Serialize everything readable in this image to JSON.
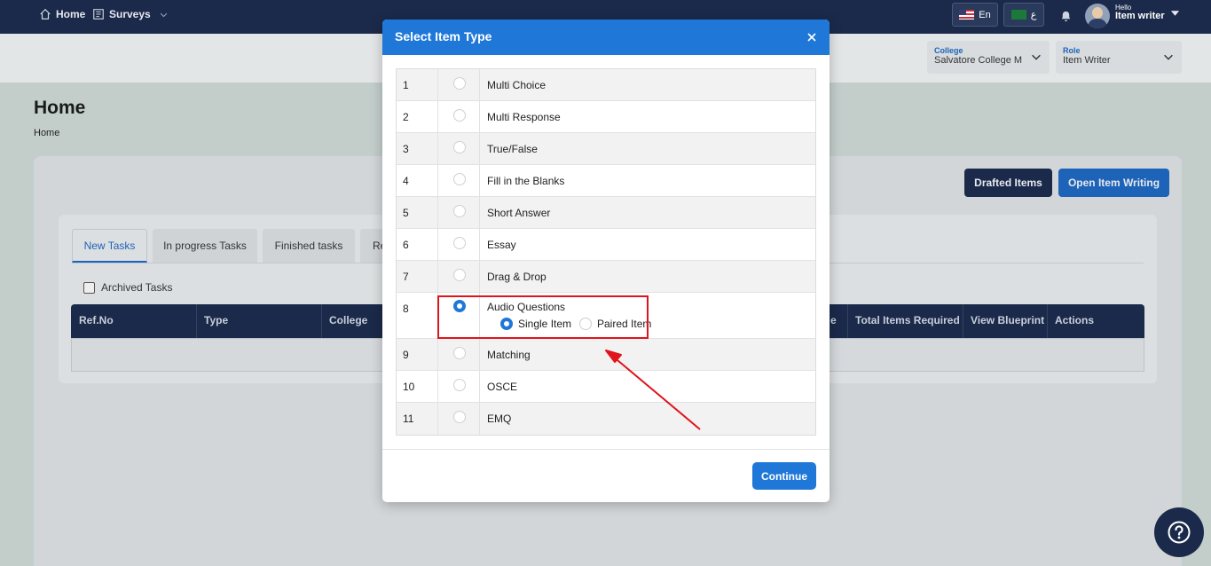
{
  "nav": {
    "home": "Home",
    "surveys": "Surveys",
    "lang_en": "En",
    "lang_ar": "ع",
    "hello": "Hello",
    "user": "Item writer"
  },
  "selectors": {
    "college_label": "College",
    "college_value": "Salvatore College M",
    "role_label": "Role",
    "role_value": "Item Writer"
  },
  "page": {
    "title": "Home",
    "breadcrumb": "Home",
    "drafted_label": "Drafted Items",
    "open_label": "Open Item Writing"
  },
  "tabs": [
    "New Tasks",
    "In progress Tasks",
    "Finished tasks",
    "Re"
  ],
  "archived_label": "Archived Tasks",
  "columns": [
    "Ref.No",
    "Type",
    "College",
    "e",
    "Total Items Required",
    "View Blueprint",
    "Actions"
  ],
  "modal": {
    "title": "Select Item Type",
    "continue_label": "Continue",
    "items": [
      {
        "num": "1",
        "label": "Multi Choice",
        "selected": false
      },
      {
        "num": "2",
        "label": "Multi Response",
        "selected": false
      },
      {
        "num": "3",
        "label": "True/False",
        "selected": false
      },
      {
        "num": "4",
        "label": "Fill in the Blanks",
        "selected": false
      },
      {
        "num": "5",
        "label": "Short Answer",
        "selected": false
      },
      {
        "num": "6",
        "label": "Essay",
        "selected": false
      },
      {
        "num": "7",
        "label": "Drag & Drop",
        "selected": false
      },
      {
        "num": "8",
        "label": "Audio Questions",
        "selected": true
      },
      {
        "num": "9",
        "label": "Matching",
        "selected": false
      },
      {
        "num": "10",
        "label": "OSCE",
        "selected": false
      },
      {
        "num": "11",
        "label": "EMQ",
        "selected": false
      }
    ],
    "sub_options": [
      {
        "label": "Single Item",
        "selected": true
      },
      {
        "label": "Paired Item",
        "selected": false
      }
    ]
  },
  "colors": {
    "navy": "#1b2a4a",
    "blue": "#1f78d8",
    "highlight": "#e0141b"
  }
}
